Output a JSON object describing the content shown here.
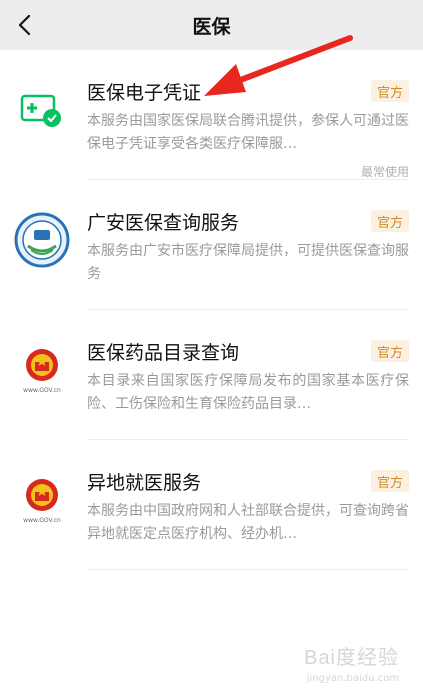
{
  "header": {
    "title": "医保"
  },
  "items": [
    {
      "name": "医保电子凭证",
      "badge": "官方",
      "description": "本服务由国家医保局联合腾讯提供，参保人可通过医保电子凭证享受各类医疗保障服…",
      "meta": "最常使用",
      "icon": "medical-card-icon"
    },
    {
      "name": "广安医保查询服务",
      "badge": "官方",
      "description": "本服务由广安市医疗保障局提供，可提供医保查询服务",
      "meta": "",
      "icon": "insurance-seal-icon"
    },
    {
      "name": "医保药品目录查询",
      "badge": "官方",
      "description": "本目录来自国家医疗保障局发布的国家基本医疗保险、工伤保险和生育保险药品目录…",
      "meta": "",
      "icon": "national-emblem-icon"
    },
    {
      "name": "异地就医服务",
      "badge": "官方",
      "description": "本服务由中国政府网和人社部联合提供，可查询跨省异地就医定点医疗机构、经办机…",
      "meta": "",
      "icon": "national-emblem-icon"
    }
  ],
  "emblem_caption": "www.GOV.cn",
  "watermark": {
    "main": "Bai度经验",
    "sub": "jingyan.baidu.com"
  },
  "colors": {
    "badge_bg": "#fbf1e3",
    "badge_text": "#d08a2a",
    "arrow": "#e8281f",
    "brand_green": "#07c160"
  }
}
